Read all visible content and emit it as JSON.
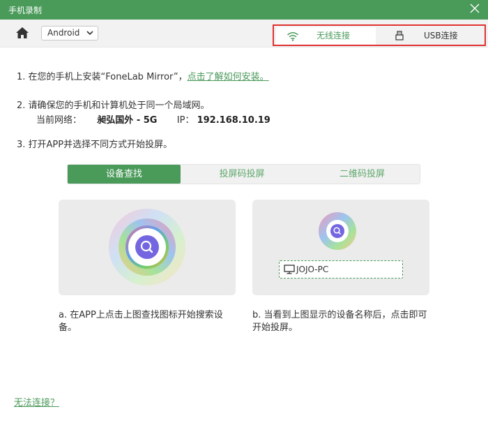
{
  "window": {
    "title": "手机录制"
  },
  "toolbar": {
    "os_select": "Android"
  },
  "connection_tabs": [
    {
      "label": "无线连接",
      "active": true
    },
    {
      "label": "USB连接",
      "active": false
    }
  ],
  "steps": {
    "step1_text": "1. 在您的手机上安装“FoneLab Mirror”，",
    "step1_link": "点击了解如何安装。",
    "step2_text": "2. 请确保您的手机和计算机处于同一个局域网。",
    "network_label": "当前网络：",
    "network_name": "昶弘国外 - 5G",
    "ip_label": "IP：",
    "ip_value": "192.168.10.19",
    "step3_text": "3. 打开APP并选择不同方式开始投屏。"
  },
  "methods": [
    {
      "label": "设备查找",
      "active": true
    },
    {
      "label": "投屏码投屏",
      "active": false
    },
    {
      "label": "二维码投屏",
      "active": false
    }
  ],
  "device": {
    "name": "JOJO-PC"
  },
  "descriptions": {
    "a": "a. 在APP上点击上图查找图标开始搜索设备。",
    "b": "b. 当看到上图显示的设备名称后，点击即可开始投屏。"
  },
  "help_link": "无法连接？",
  "colors": {
    "accent": "#4a9a5a",
    "highlight_border": "#e03131"
  }
}
